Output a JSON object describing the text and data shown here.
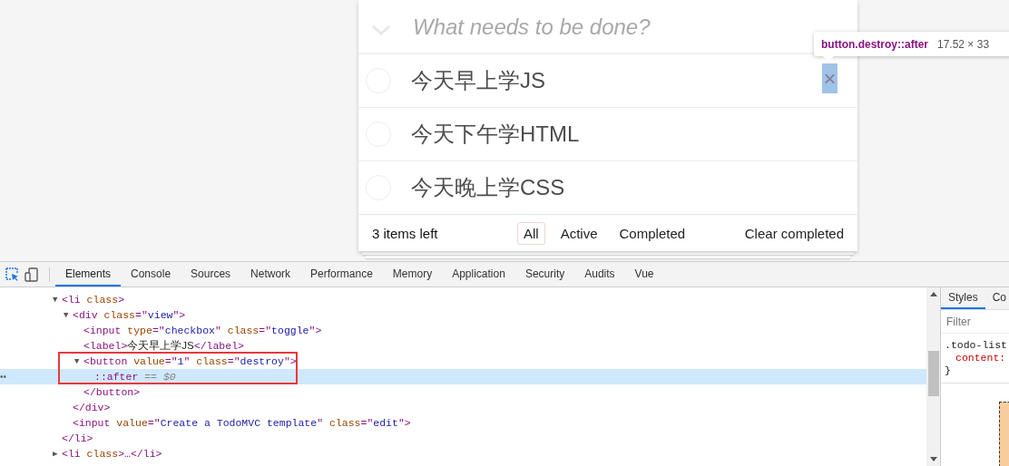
{
  "todo": {
    "placeholder": "What needs to be done?",
    "items": [
      {
        "label": "今天早上学JS",
        "completed": false,
        "destroy": "×"
      },
      {
        "label": "今天下午学HTML",
        "completed": false
      },
      {
        "label": "今天晚上学CSS",
        "completed": false
      }
    ],
    "count": "3 items left",
    "filters": [
      {
        "label": "All",
        "selected": true
      },
      {
        "label": "Active",
        "selected": false
      },
      {
        "label": "Completed",
        "selected": false
      }
    ],
    "clear": "Clear completed"
  },
  "tooltip": {
    "selector": "button.destroy::after",
    "size": "17.52 × 33"
  },
  "devtools": {
    "tabs": [
      {
        "label": "Elements",
        "selected": true
      },
      {
        "label": "Console",
        "selected": false
      },
      {
        "label": "Sources",
        "selected": false
      },
      {
        "label": "Network",
        "selected": false
      },
      {
        "label": "Performance",
        "selected": false
      },
      {
        "label": "Memory",
        "selected": false
      },
      {
        "label": "Application",
        "selected": false
      },
      {
        "label": "Security",
        "selected": false
      },
      {
        "label": "Audits",
        "selected": false
      },
      {
        "label": "Vue",
        "selected": false
      }
    ],
    "dom": [
      {
        "arrow": "▼",
        "selected": false,
        "parts": [
          {
            "kind": "tag",
            "text": "<li "
          },
          {
            "kind": "attr",
            "text": "class"
          },
          {
            "kind": "tag",
            "text": ">"
          }
        ],
        "children": [
          {
            "arrow": "▼",
            "selected": false,
            "parts": [
              {
                "kind": "tag",
                "text": "<div "
              },
              {
                "kind": "attr",
                "text": "class"
              },
              {
                "kind": "tag",
                "text": "=\""
              },
              {
                "kind": "value",
                "text": "view"
              },
              {
                "kind": "tag",
                "text": "\">"
              }
            ],
            "children": [
              {
                "selected": false,
                "parts": [
                  {
                    "kind": "tag",
                    "text": "<input "
                  },
                  {
                    "kind": "attr",
                    "text": "type"
                  },
                  {
                    "kind": "tag",
                    "text": "=\""
                  },
                  {
                    "kind": "value",
                    "text": "checkbox"
                  },
                  {
                    "kind": "tag",
                    "text": "\" "
                  },
                  {
                    "kind": "attr",
                    "text": "class"
                  },
                  {
                    "kind": "tag",
                    "text": "=\""
                  },
                  {
                    "kind": "value",
                    "text": "toggle"
                  },
                  {
                    "kind": "tag",
                    "text": "\">"
                  }
                ]
              },
              {
                "selected": false,
                "parts": [
                  {
                    "kind": "tag",
                    "text": "<label>"
                  },
                  {
                    "kind": "text",
                    "text": "今天早上学JS"
                  },
                  {
                    "kind": "tag",
                    "text": "</label>"
                  }
                ]
              },
              {
                "arrow": "▼",
                "selected": false,
                "parts": [
                  {
                    "kind": "tag",
                    "text": "<button "
                  },
                  {
                    "kind": "attr",
                    "text": "value"
                  },
                  {
                    "kind": "tag",
                    "text": "=\""
                  },
                  {
                    "kind": "value",
                    "text": "1"
                  },
                  {
                    "kind": "tag",
                    "text": "\" "
                  },
                  {
                    "kind": "attr",
                    "text": "class"
                  },
                  {
                    "kind": "tag",
                    "text": "=\""
                  },
                  {
                    "kind": "value",
                    "text": "destroy"
                  },
                  {
                    "kind": "tag",
                    "text": "\">"
                  }
                ],
                "children": [
                  {
                    "selected": true,
                    "marker": "••",
                    "parts": [
                      {
                        "kind": "pseudo",
                        "text": "::after"
                      },
                      {
                        "kind": "ref",
                        "text": " == $0"
                      }
                    ]
                  }
                ]
              },
              {
                "selected": false,
                "parts": [
                  {
                    "kind": "tag",
                    "text": "</button>"
                  }
                ]
              }
            ]
          },
          {
            "selected": false,
            "parts": [
              {
                "kind": "tag",
                "text": "</div>"
              }
            ]
          },
          {
            "selected": false,
            "parts": [
              {
                "kind": "tag",
                "text": "<input "
              },
              {
                "kind": "attr",
                "text": "value"
              },
              {
                "kind": "tag",
                "text": "=\""
              },
              {
                "kind": "value",
                "text": "Create a TodoMVC template"
              },
              {
                "kind": "tag",
                "text": "\" "
              },
              {
                "kind": "attr",
                "text": "class"
              },
              {
                "kind": "tag",
                "text": "=\""
              },
              {
                "kind": "value",
                "text": "edit"
              },
              {
                "kind": "tag",
                "text": "\">"
              }
            ]
          }
        ]
      },
      {
        "selected": false,
        "parts": [
          {
            "kind": "tag",
            "text": "</li>"
          }
        ]
      },
      {
        "arrow": "▶",
        "selected": false,
        "parts": [
          {
            "kind": "tag",
            "text": "<li "
          },
          {
            "kind": "attr",
            "text": "class"
          },
          {
            "kind": "tag",
            "text": ">…</li>"
          }
        ]
      }
    ],
    "side_tabs": [
      {
        "label": "Styles",
        "selected": true
      },
      {
        "label": "Co",
        "selected": false
      }
    ],
    "filter_placeholder": "Filter",
    "rule": {
      "selector": ".todo-list",
      "property": "content:",
      "close": "}"
    }
  }
}
